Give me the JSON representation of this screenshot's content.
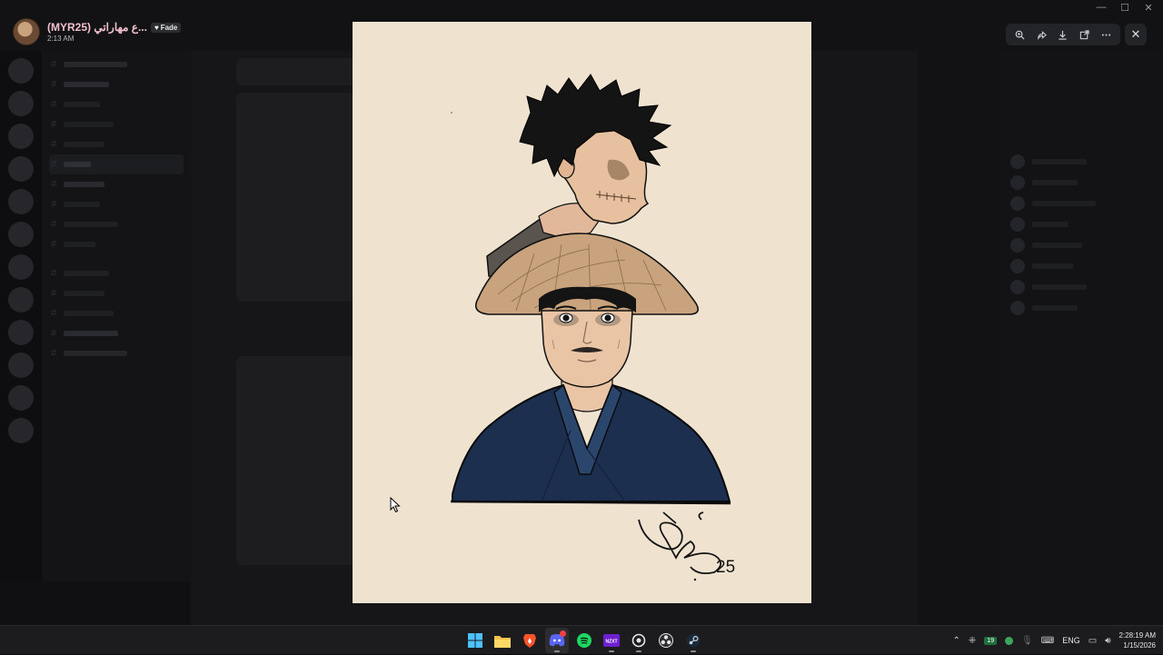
{
  "viewer": {
    "user_name": "(MYR25) ع مهاراتي...",
    "tag_label": "Fade",
    "timestamp": "2:13 AM"
  },
  "toolbar": {
    "zoom_icon": "zoom-in-icon",
    "forward_icon": "forward-icon",
    "download_icon": "download-icon",
    "open_icon": "open-external-icon",
    "more_icon": "more-icon",
    "close_icon": "close-icon"
  },
  "artwork": {
    "signature_year": "25",
    "colors": {
      "paper": "#efe3d0",
      "robe": "#1c2f4f",
      "hat": "#c9a37d",
      "hair": "#141414",
      "skin": "#e9c5a6"
    }
  },
  "taskbar": {
    "apps": [
      "windows-start",
      "file-explorer",
      "brave",
      "discord",
      "spotify",
      "nzxt-cam",
      "steam-helper",
      "obs",
      "steam"
    ],
    "tray_badge": "19",
    "language": "ENG",
    "time": "2:28:19 AM",
    "date": "1/15/2026"
  }
}
